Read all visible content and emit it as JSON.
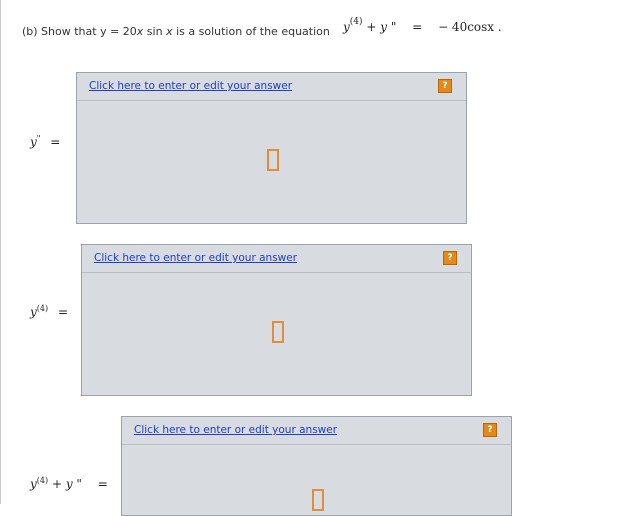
{
  "prompt": {
    "part": "(b) Show that y = 20",
    "var_x": "x",
    "mid": " sin ",
    "var_x2": "x",
    "tail": " is a solution of the equation"
  },
  "equation": {
    "y": "y",
    "sup4": "(4)",
    "plus": " + ",
    "y2": "y",
    "prime": " \"",
    "equals": "=",
    "rhs": "− 40cosx ."
  },
  "fields": [
    {
      "label_y": "y",
      "label_sup": "\"",
      "equals": "=",
      "link": "Click here to enter or edit your answer",
      "help": "?"
    },
    {
      "label_y": "y",
      "label_sup": "(4)",
      "equals": "=",
      "link": "Click here to enter or edit your answer",
      "help": "?"
    },
    {
      "label_y": "y",
      "label_sup": "(4)",
      "label_plus": " + ",
      "label_y2": "y",
      "label_prime": " \"",
      "equals": "=",
      "link": "Click here to enter or edit your answer",
      "help": "?"
    }
  ]
}
